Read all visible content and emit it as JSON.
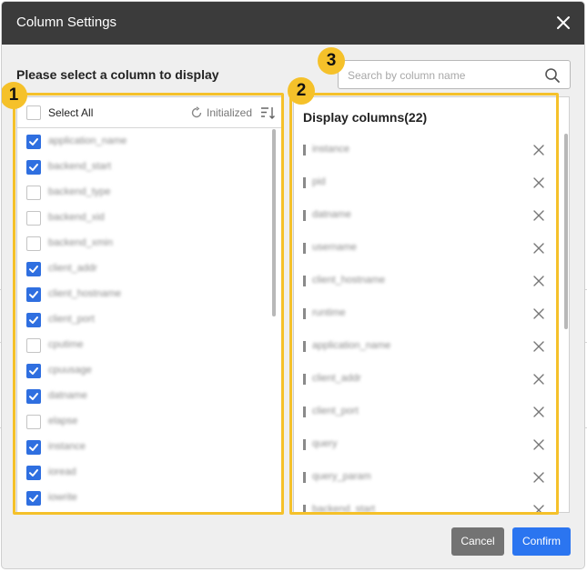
{
  "dialog": {
    "title": "Column Settings",
    "section_title": "Please select a column to display"
  },
  "search": {
    "placeholder": "Search by column name"
  },
  "left": {
    "select_all": "Select All",
    "initialized": "Initialized",
    "columns": [
      {
        "label": "application_name",
        "checked": true
      },
      {
        "label": "backend_start",
        "checked": true
      },
      {
        "label": "backend_type",
        "checked": false
      },
      {
        "label": "backend_xid",
        "checked": false
      },
      {
        "label": "backend_xmin",
        "checked": false
      },
      {
        "label": "client_addr",
        "checked": true
      },
      {
        "label": "client_hostname",
        "checked": true
      },
      {
        "label": "client_port",
        "checked": true
      },
      {
        "label": "cputime",
        "checked": false
      },
      {
        "label": "cpuusage",
        "checked": true
      },
      {
        "label": "datname",
        "checked": true
      },
      {
        "label": "elapse",
        "checked": false
      },
      {
        "label": "instance",
        "checked": true
      },
      {
        "label": "ioread",
        "checked": true
      },
      {
        "label": "iowrite",
        "checked": true
      }
    ]
  },
  "right": {
    "title": "Display columns(22)",
    "columns": [
      "instance",
      "pid",
      "datname",
      "username",
      "client_hostname",
      "runtime",
      "application_name",
      "client_addr",
      "client_port",
      "query",
      "query_param",
      "backend_start"
    ]
  },
  "badges": [
    "1",
    "2",
    "3"
  ],
  "buttons": {
    "cancel": "Cancel",
    "confirm": "Confirm"
  },
  "colors": {
    "accent": "#2b75f0",
    "highlight": "#f5c12a",
    "titlebar": "#3b3b3b"
  }
}
